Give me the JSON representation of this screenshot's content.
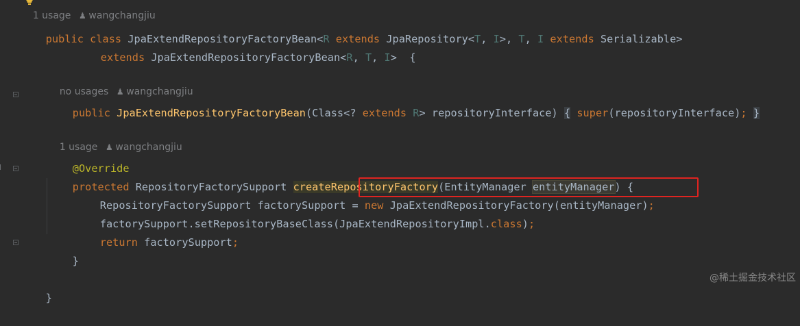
{
  "hints": {
    "top": {
      "usage": "1 usage",
      "author": "wangchangjiu"
    },
    "constructor": {
      "usage": "no usages",
      "author": "wangchangjiu"
    },
    "method": {
      "usage": "1 usage",
      "author": "wangchangjiu"
    }
  },
  "code": {
    "l1": {
      "k_public": "public",
      "k_class": "class",
      "name": "JpaExtendRepositoryFactoryBean",
      "lt": "<",
      "t_R": "R",
      "k_extends": "extends",
      "repo": "JpaRepository<",
      "t_T": "T",
      "comma1": ", ",
      "t_I": "I",
      "gt": ">, ",
      "t_T2": "T",
      "comma2": ", ",
      "t_I2": "I",
      "k_extends2": "extends",
      "ser": "Serializable>"
    },
    "l2": {
      "k_extends": "extends",
      "base": "JpaExtendRepositoryFactoryBean<",
      "t_R": "R",
      "c1": ", ",
      "t_T": "T",
      "c2": ", ",
      "t_I": "I",
      "tail": ">  {"
    },
    "l3": {
      "k_public": "public",
      "ctor": "JpaExtendRepositoryFactoryBean",
      "p1": "(Class<? ",
      "k_extends": "extends",
      "t_R": "R",
      "p2": "> repositoryInterface)",
      "brace_open": "{",
      "k_super": "super",
      "p3": "(repositoryInterface)",
      "semi": ";",
      "brace_close": "}"
    },
    "l4": {
      "annotation": "@Override"
    },
    "l5": {
      "k_protected": "protected",
      "ret": "RepositoryFactorySupport",
      "fn": "createRepositoryFactory",
      "p1": "(EntityManager ",
      "param": "entityManager",
      "p2": ") {"
    },
    "l6": {
      "decl": "RepositoryFactorySupport factorySupport = ",
      "k_new": "new",
      "rest": "JpaExtendRepositoryFactory(entityManager)",
      "semi": ";"
    },
    "l7": {
      "call": "factorySupport.setRepositoryBaseClass(JpaExtendRepositoryImpl.",
      "k_class": "class",
      "close": ")",
      "semi": ";"
    },
    "l8": {
      "k_return": "return",
      "val": "factorySupport",
      "semi": ";"
    },
    "l9": {
      "brace": "}"
    },
    "l10": {
      "brace": "}"
    }
  },
  "watermark": "@稀土掘金技术社区",
  "colors": {
    "background": "#2b2b2b",
    "keyword": "#cc7832",
    "function": "#ffc66d",
    "type_param": "#507874",
    "annotation": "#bbb529",
    "text": "#a9b7c6",
    "highlight_box": "#e02420"
  }
}
